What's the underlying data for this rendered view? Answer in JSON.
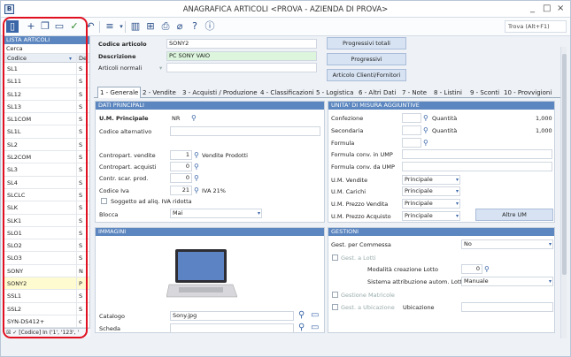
{
  "window": {
    "title": "ANAGRAFICA ARTICOLI <PROVA - AZIENDA DI PROVA>",
    "app_icon": "app-icon",
    "controls": [
      "_",
      "□",
      "×"
    ]
  },
  "toolbar": {
    "search": "Trova (Alt+F1)",
    "icons": [
      "list-icon",
      "add-icon",
      "copy-icon",
      "folder-icon",
      "check-icon",
      "undo-icon",
      "menu-icon",
      "barcode-icon",
      "basket-icon",
      "print-icon",
      "attach-icon",
      "help-icon",
      "info-icon"
    ]
  },
  "left": {
    "header": "LISTA ARTICOLI",
    "cerca": "Cerca",
    "col_codice": "Codice",
    "col_desc": "Des",
    "rows": [
      {
        "c": "SL1",
        "d": "S"
      },
      {
        "c": "SL11",
        "d": "S"
      },
      {
        "c": "SL12",
        "d": "S"
      },
      {
        "c": "SL13",
        "d": "S"
      },
      {
        "c": "SL1COM",
        "d": "S"
      },
      {
        "c": "SL1L",
        "d": "S"
      },
      {
        "c": "SL2",
        "d": "S"
      },
      {
        "c": "SL2COM",
        "d": "S"
      },
      {
        "c": "SL3",
        "d": "S"
      },
      {
        "c": "SL4",
        "d": "S"
      },
      {
        "c": "SLCLC",
        "d": "S"
      },
      {
        "c": "SLK",
        "d": "S"
      },
      {
        "c": "SLK1",
        "d": "S"
      },
      {
        "c": "SLO1",
        "d": "S"
      },
      {
        "c": "SLO2",
        "d": "S"
      },
      {
        "c": "SLO3",
        "d": "S"
      },
      {
        "c": "SONY",
        "d": "N"
      },
      {
        "c": "SONY2",
        "d": "P"
      },
      {
        "c": "SSL1",
        "d": "S"
      },
      {
        "c": "SSL2",
        "d": "S"
      },
      {
        "c": "SYN-DS412+",
        "d": "c"
      }
    ],
    "filter": "[Codice] In ('1', '123', '"
  },
  "header_fields": {
    "codice_label": "Codice articolo",
    "codice": "SONY2",
    "descr_label": "Descrizione",
    "descr": "PC SONY VAIO",
    "normali_label": "Articoli normali",
    "btn_totali": "Progressivi totali",
    "btn_progressivi": "Progressivi",
    "btn_clienti": "Articolo Clienti/Fornitori"
  },
  "tabs": [
    "1 - Generale",
    "2 - Vendite",
    "3 - Acquisti / Produzione",
    "4 - Classificazioni",
    "5 - Logistica",
    "6 - Altri Dati",
    "7 - Note",
    "8 - Listini",
    "9 - Sconti",
    "10 - Provvigioni"
  ],
  "dati": {
    "header": "DATI PRINCIPALI",
    "um_label": "U.M. Principale",
    "um": "NR",
    "alt_label": "Codice alternativo",
    "cv_label": "Contropart. vendite",
    "cv_num": "1",
    "cv_desc": "Vendite Prodotti",
    "ca_label": "Contropart. acquisti",
    "ca_num": "0",
    "cs_label": "Contr. scar. prod.",
    "cs_num": "0",
    "iva_label": "Codice Iva",
    "iva_num": "21",
    "iva_desc": "IVA 21%",
    "sogg_label": "Soggetto ad aliq. IVA ridotta",
    "blocca_label": "Blocca",
    "blocca": "Mai"
  },
  "um": {
    "header": "UNITA' DI MISURA AGGIUNTIVE",
    "conf": "Confezione",
    "sec": "Secondaria",
    "quant": "Quantità",
    "q1": "1,000",
    "q2": "1,000",
    "formula": "Formula",
    "f_um": "Formula conv. in UMP",
    "f_da": "Formula conv. da UMP",
    "umv": "U.M. Vendite",
    "umc": "U.M. Carichi",
    "ump": "U.M. Prezzo Vendita",
    "uma": "U.M. Prezzo Acquisto",
    "principale": "Principale",
    "altre": "Altre UM"
  },
  "immagini": {
    "header": "IMMAGINI",
    "cat_label": "Catalogo",
    "cat": "Sony.jpg",
    "scheda_label": "Scheda"
  },
  "gestioni": {
    "header": "GESTIONI",
    "commessa_label": "Gest. per Commessa",
    "commessa": "No",
    "lotti": "Gest. a Lotti",
    "mod_label": "Modalità creazione Lotto",
    "mod": "0",
    "sist_label": "Sistema attribuzione autom. Lotto",
    "sist": "Manuale",
    "matricole": "Gestione Matricole",
    "ubicazione": "Gest. a Ubicazione",
    "ubic_label": "Ubicazione"
  }
}
